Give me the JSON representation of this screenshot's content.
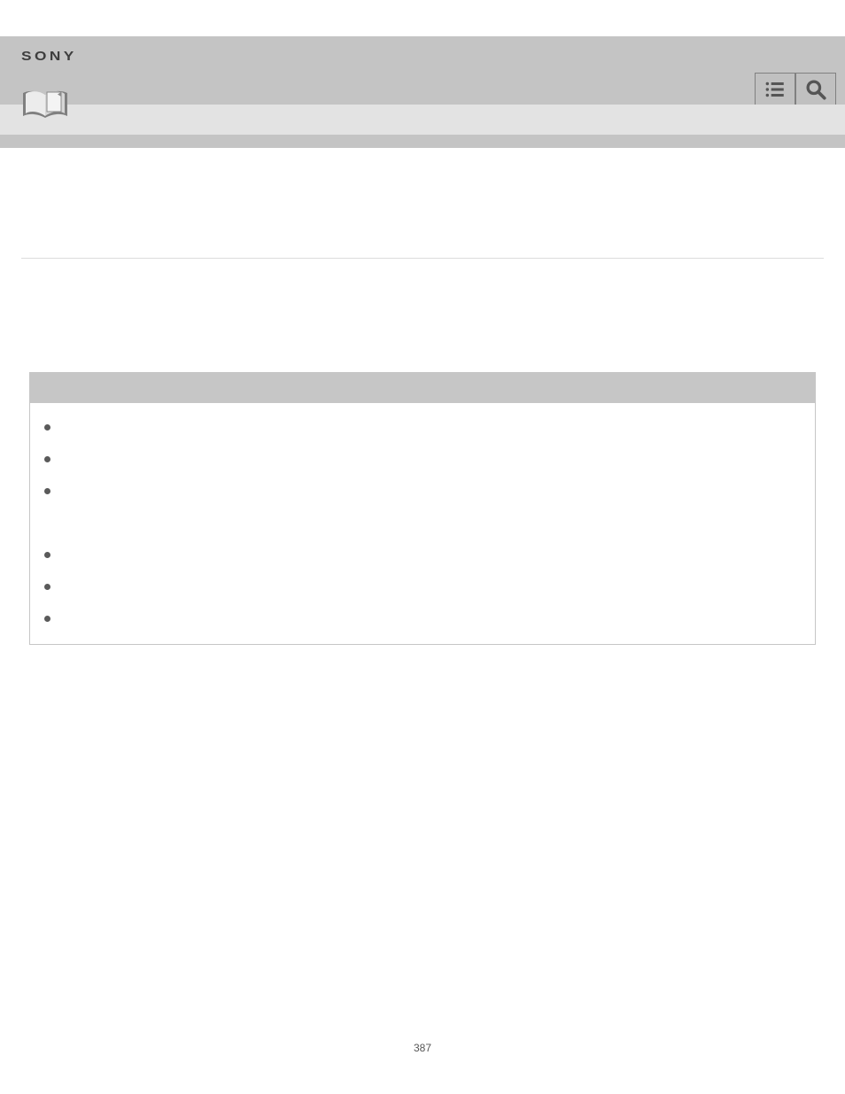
{
  "brand": "SONY",
  "icons": {
    "menu": "menu-icon",
    "search": "search-icon",
    "book": "book-icon"
  },
  "note": {
    "header": "",
    "items": [
      "",
      "",
      "",
      "",
      "",
      ""
    ]
  },
  "page_number": "387"
}
